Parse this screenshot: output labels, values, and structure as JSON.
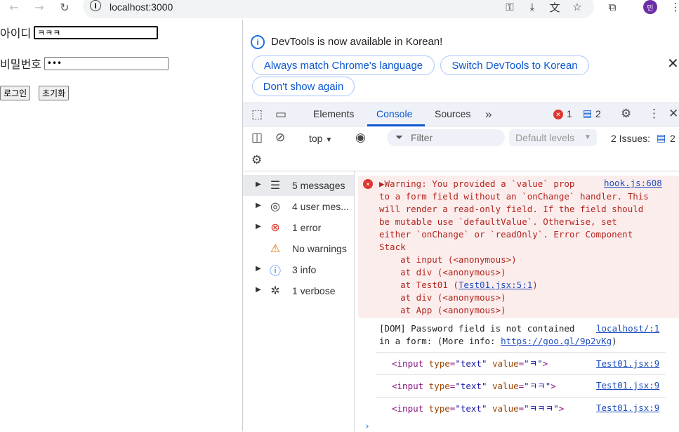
{
  "browser": {
    "url": "localhost:3000",
    "avatar_initial": "민",
    "back_icon": "arrow-left-icon",
    "forward_icon": "arrow-right-icon",
    "reload_icon": "reload-icon"
  },
  "page": {
    "id_label": "아이디",
    "id_value": "ㅋㅋㅋ",
    "pw_label": "비밀번호",
    "pw_value": "ㅋㅋㅋ",
    "login_button": "로그인",
    "reset_button": "초기화"
  },
  "devtools": {
    "banner_text": "DevTools is now available in Korean!",
    "btn_always_match": "Always match Chrome's language",
    "btn_switch_korean": "Switch DevTools to Korean",
    "btn_dont_show": "Don't show again",
    "tabs": [
      "Elements",
      "Console",
      "Sources"
    ],
    "active_tab": "Console",
    "error_count": "1",
    "message_count": "2",
    "context": "top",
    "filter_placeholder": "Filter",
    "levels": "Default levels",
    "issues_label": "2 Issues:",
    "issues_count": "2",
    "accent": "#0b57d0",
    "error_color": "#dc362e"
  },
  "sidebar": [
    {
      "label": "5 messages",
      "icon": "list-icon",
      "expandable": true,
      "selected": true
    },
    {
      "label": "4 user mes...",
      "icon": "user-icon",
      "expandable": true,
      "selected": false
    },
    {
      "label": "1 error",
      "icon": "error-icon",
      "expandable": true,
      "selected": false
    },
    {
      "label": "No warnings",
      "icon": "warning-icon",
      "expandable": false,
      "selected": false
    },
    {
      "label": "3 info",
      "icon": "info-icon",
      "expandable": true,
      "selected": false
    },
    {
      "label": "1 verbose",
      "icon": "bug-icon",
      "expandable": true,
      "selected": false
    }
  ],
  "console": {
    "error": {
      "l1_pre": "▶Warning: You provided a `value` prop",
      "source": "hook.js:608",
      "lines": [
        "to a form field without an `onChange` handler. This",
        "will render a read-only field. If the field should",
        "be mutable use `defaultValue`. Otherwise, set",
        "either `onChange` or `readOnly`. Error Component",
        "Stack",
        "    at input (<anonymous>)",
        "    at div (<anonymous>)"
      ],
      "test_pre": "    at Test01 (",
      "test_link": "Test01.jsx:5:1",
      "test_post": ")",
      "tail": [
        "    at div (<anonymous>)",
        "    at App (<anonymous>)"
      ]
    },
    "dom": {
      "line1": "[DOM] Password field is not contained",
      "source": "localhost/:1",
      "line2_pre": "in a form: (More info: ",
      "line2_link": "https://goo.gl/9p2vKg",
      "line2_post": ")"
    },
    "logs": [
      {
        "tag_open": "<input",
        "attr1": " type",
        "eq1": "=",
        "val1": "\"text\"",
        "attr2": " value",
        "eq2": "=",
        "val2": "\"ㅋ\"",
        "close": ">",
        "source": "Test01.jsx:9"
      },
      {
        "tag_open": "<input",
        "attr1": " type",
        "eq1": "=",
        "val1": "\"text\"",
        "attr2": " value",
        "eq2": "=",
        "val2": "\"ㅋㅋ\"",
        "close": ">",
        "source": "Test01.jsx:9"
      },
      {
        "tag_open": "<input",
        "attr1": " type",
        "eq1": "=",
        "val1": "\"text\"",
        "attr2": " value",
        "eq2": "=",
        "val2": "\"ㅋㅋㅋ\"",
        "close": ">",
        "source": "Test01.jsx:9"
      }
    ],
    "prompt": "›"
  }
}
